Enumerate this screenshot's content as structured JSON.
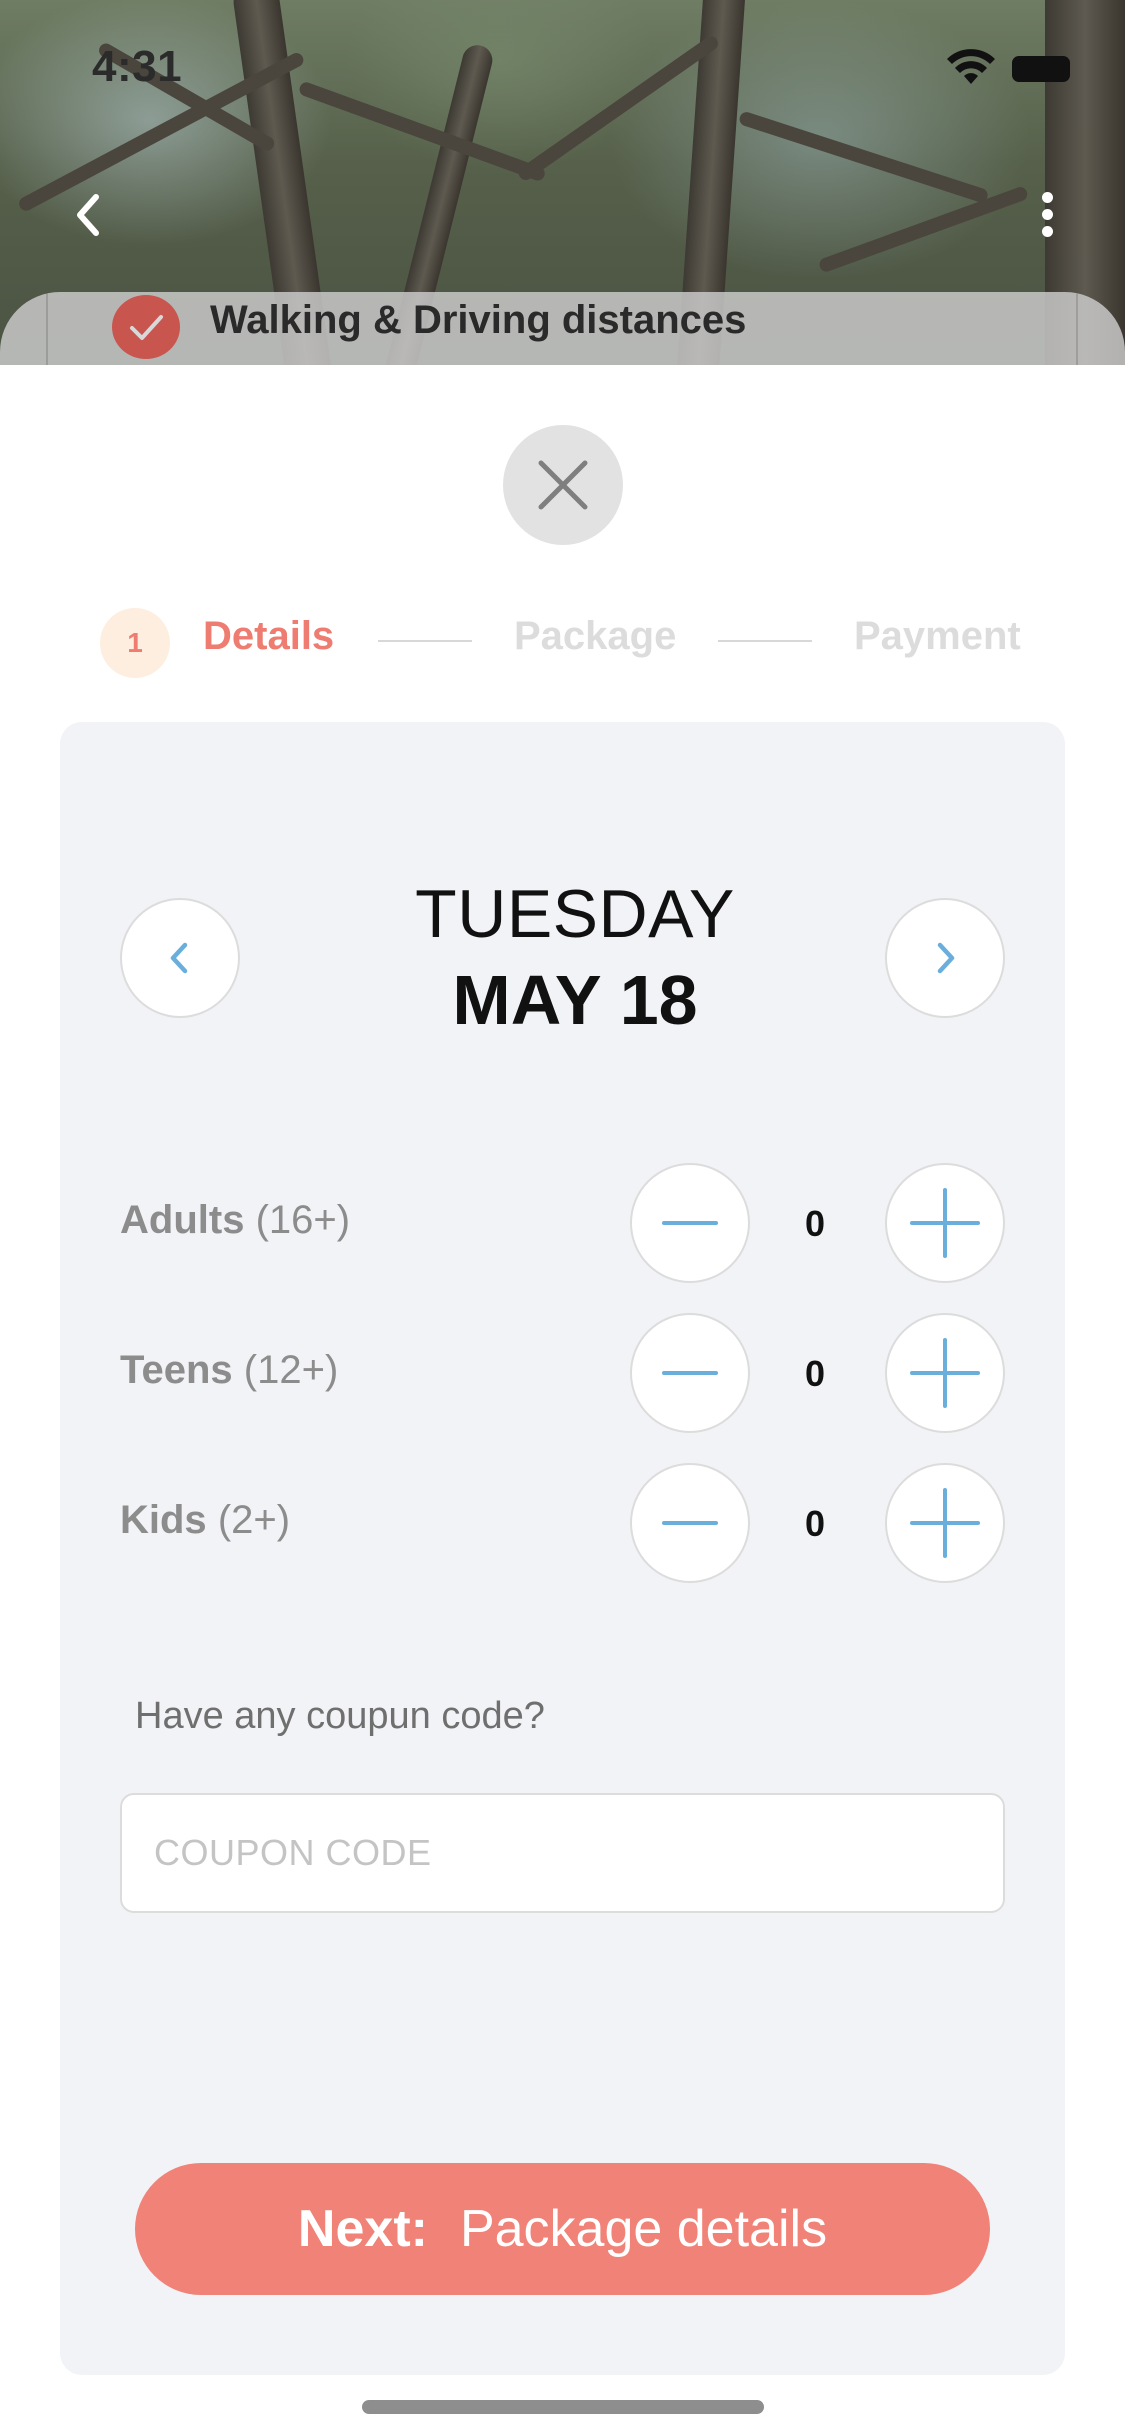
{
  "status_bar": {
    "time": "4:31"
  },
  "hero": {
    "feature_text": "Walking & Driving distances"
  },
  "steps": [
    {
      "number": "1",
      "label": "Details"
    },
    {
      "label": "Package"
    },
    {
      "label": "Payment"
    }
  ],
  "date": {
    "day": "TUESDAY",
    "date": "MAY 18"
  },
  "guests": [
    {
      "label": "Adults",
      "range": "(16+)",
      "count": "0"
    },
    {
      "label": "Teens",
      "range": "(12+)",
      "count": "0"
    },
    {
      "label": "Kids",
      "range": "(2+)",
      "count": "0"
    }
  ],
  "coupon": {
    "prompt": "Have any coupun code?",
    "placeholder": "COUPON CODE",
    "value": ""
  },
  "next_button": {
    "strong": "Next:",
    "label": "Package details"
  },
  "colors": {
    "accent": "#f08278",
    "icon_blue": "#6aaedb",
    "card_bg": "#f2f3f7"
  }
}
